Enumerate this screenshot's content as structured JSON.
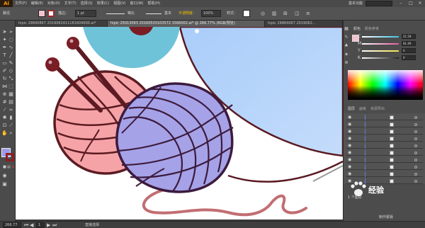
{
  "app": {
    "logo": "Ai"
  },
  "menu": [
    "文件(F)",
    "编辑(E)",
    "对象(O)",
    "文字(T)",
    "选择(S)",
    "效果(C)",
    "视图(V)",
    "窗口(W)",
    "帮助(H)"
  ],
  "workspace": "基本功能",
  "controlbar": {
    "selection_label": "路径",
    "fill_color": "#f5c2d0",
    "stroke_color": "#9b2b2f",
    "stroke_label": "描边：",
    "stroke_weight": "1 pt",
    "profile_label": "等比",
    "brush_label": "基本",
    "opacity_label": "不透明度：",
    "opacity_value": "100%",
    "style_label": "样式："
  },
  "tabs": [
    {
      "label": "hipic 29840867 2019082411181604000.ai*"
    },
    {
      "label": "hipic 25013093 20160503103572 1566002.ai* @ 266.77% (RGB/预览)"
    },
    {
      "label": "hipic 29864067 2019082..."
    }
  ],
  "panels": {
    "color_tabs": [
      "颜色",
      "颜色参考"
    ],
    "sliders": [
      {
        "label": "C",
        "value": "21.59",
        "color": "#3fc2e6"
      },
      {
        "label": "M",
        "value": "81.49",
        "color": "#e05ba0"
      },
      {
        "label": "Y",
        "value": "0",
        "color": "#f1e24a"
      },
      {
        "label": "K",
        "value": "0",
        "color": "#222222"
      }
    ],
    "layer_tabs": [
      "图层",
      "画板",
      "资源导出"
    ],
    "layer_count": "1 个图层",
    "layer_rows": 10,
    "bottom_label": "制作蒙版"
  },
  "status": {
    "zoom": "266.77",
    "page": "1",
    "tool_name": "直接选择"
  },
  "watermark": {
    "text": "经验"
  }
}
